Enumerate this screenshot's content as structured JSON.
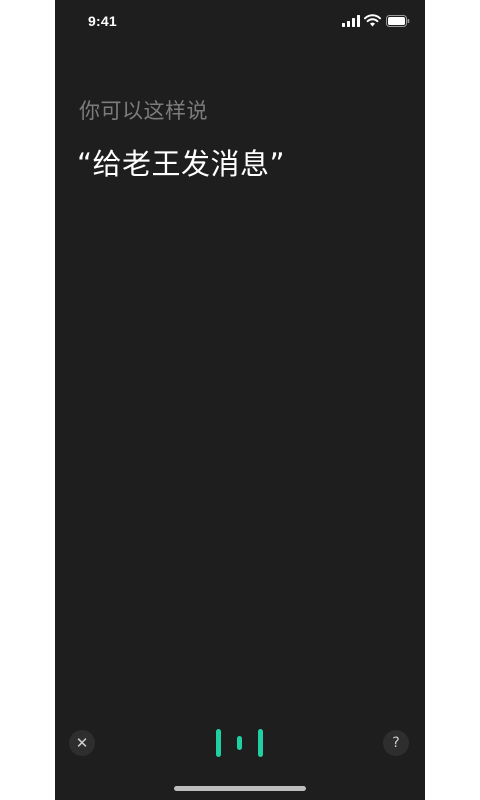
{
  "status_bar": {
    "time": "9:41",
    "icons": [
      "signal-icon",
      "wifi-icon",
      "battery-icon"
    ]
  },
  "prompt": {
    "hint": "你可以这样说",
    "example": "“给老王发消息”"
  },
  "controls": {
    "close_symbol": "✕",
    "help_symbol": "?",
    "icons": [
      "close-icon",
      "voice-wave-icon",
      "help-icon"
    ]
  },
  "colors": {
    "background": "#1e1e1e",
    "accent": "#1fd0a3",
    "hint_text": "#7c7c7c"
  }
}
